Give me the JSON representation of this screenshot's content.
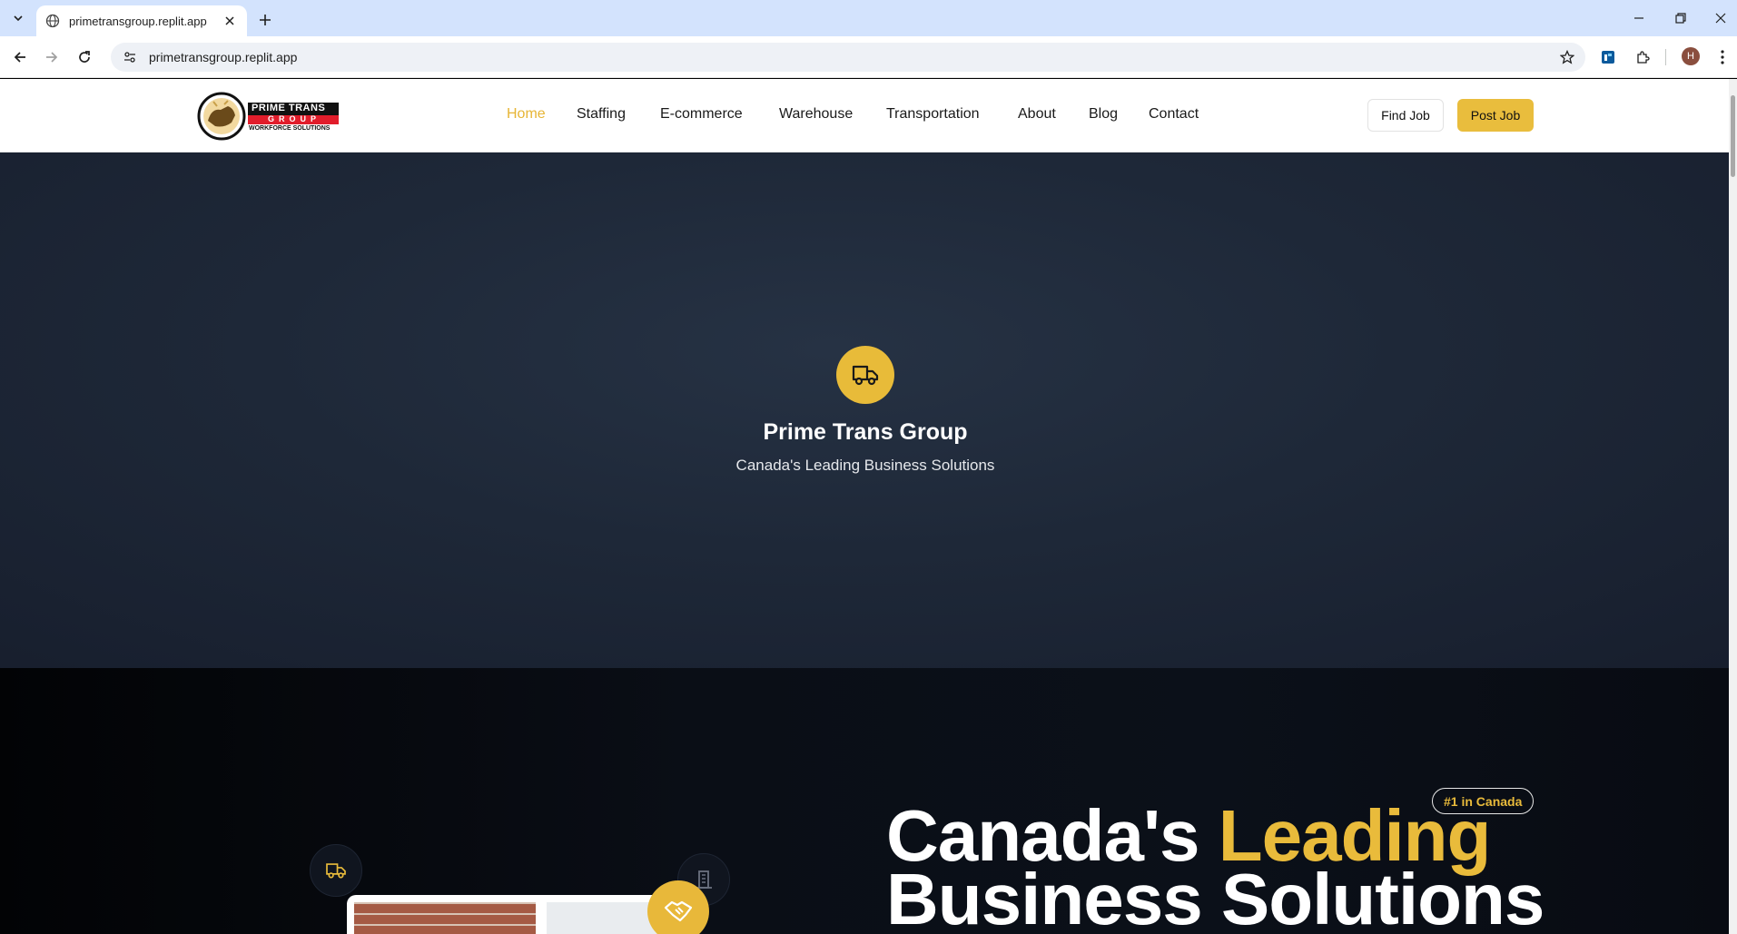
{
  "browser": {
    "tab_title": "primetransgroup.replit.app",
    "url": "primetransgroup.replit.app",
    "profile_initial": "H"
  },
  "site": {
    "nav": [
      {
        "label": "Home",
        "active": true
      },
      {
        "label": "Staffing"
      },
      {
        "label": "E-commerce"
      },
      {
        "label": "Warehouse"
      },
      {
        "label": "Transportation"
      },
      {
        "label": "About"
      },
      {
        "label": "Blog"
      },
      {
        "label": "Contact"
      }
    ],
    "find_job": "Find Job",
    "post_job": "Post Job",
    "logo": {
      "line1": "PRIME TRANS",
      "line2": "GROUP",
      "line3": "WORKFORCE SOLUTIONS"
    }
  },
  "splash": {
    "title": "Prime Trans Group",
    "subtitle": "Canada's Leading Business Solutions"
  },
  "hero": {
    "badge": "#1 in Canada",
    "headline_part1": "Canada's ",
    "headline_accent": "Leading",
    "headline_line2": "Business Solutions"
  },
  "colors": {
    "accent": "#e9bb3b",
    "dark_bg": "#1e2838",
    "tabstrip": "#d3e3fd"
  }
}
